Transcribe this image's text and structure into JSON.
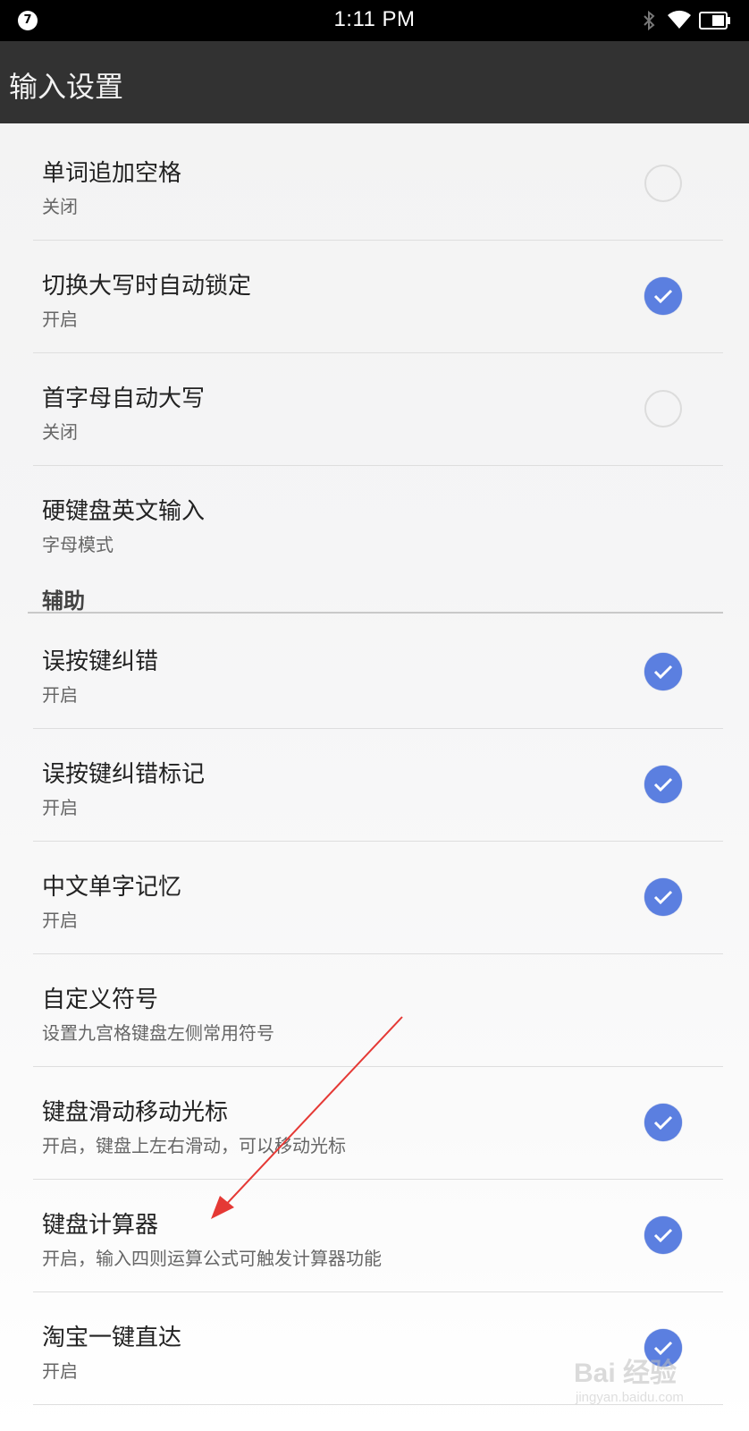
{
  "status_bar": {
    "notification_count": "7",
    "time": "1:11 PM",
    "icons": [
      "bluetooth-icon",
      "wifi-icon",
      "battery-icon"
    ]
  },
  "app_bar": {
    "title": "输入设置"
  },
  "settings": [
    {
      "title": "单词追加空格",
      "summary": "关闭",
      "checked": false
    },
    {
      "title": "切换大写时自动锁定",
      "summary": "开启",
      "checked": true
    },
    {
      "title": "首字母自动大写",
      "summary": "关闭",
      "checked": false
    },
    {
      "title": "硬键盘英文输入",
      "summary": "字母模式"
    }
  ],
  "section": {
    "title": "辅助"
  },
  "assist_settings": [
    {
      "title": "误按键纠错",
      "summary": "开启",
      "checked": true
    },
    {
      "title": "误按键纠错标记",
      "summary": "开启",
      "checked": true
    },
    {
      "title": "中文单字记忆",
      "summary": "开启",
      "checked": true
    },
    {
      "title": "自定义符号",
      "summary": "设置九宫格键盘左侧常用符号"
    },
    {
      "title": "键盘滑动移动光标",
      "summary": "开启，键盘上左右滑动，可以移动光标",
      "checked": true
    },
    {
      "title": "键盘计算器",
      "summary": "开启，输入四则运算公式可触发计算器功能",
      "checked": true
    },
    {
      "title": "淘宝一键直达",
      "summary": "开启",
      "checked": true
    }
  ],
  "colors": {
    "accent": "#5b7fe0",
    "app_bar": "#323232",
    "annotation_arrow": "#e53935"
  },
  "watermark": {
    "text": "Bai 经验",
    "url": "jingyan.baidu.com"
  }
}
